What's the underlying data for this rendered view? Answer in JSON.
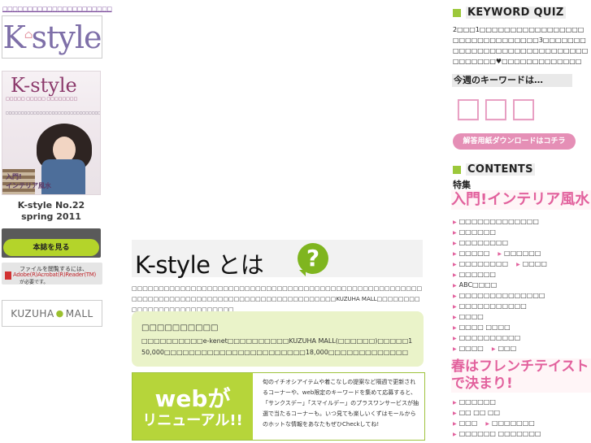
{
  "left": {
    "tiny_link": "□□□□□□□□□□□□□□□□□□□□□□",
    "logo": "K",
    "logo_rest": "style",
    "cover": {
      "title": "K-style",
      "sub": "□□□□□ □□□□□ □□□□□□□□",
      "lines": "□□□□□□□□□□□□□□□□□□□□□□□□□□□□□□□□□□□□□",
      "heading1": "入門!",
      "heading2": "インテリア風水"
    },
    "magazine_title_line1": "K-style No.22",
    "magazine_title_line2": "spring 2011",
    "read_button": "本誌を見る",
    "acrobat": {
      "line1": "ファイルを閲覧するには、",
      "line2": "Adobe(R)Acrobat(R)Reader(TM)",
      "line3": "が必要です。"
    },
    "mall_button_left": "KUZUHA",
    "mall_button_right": "MALL"
  },
  "center": {
    "title": "K-style とは",
    "question_mark": "?",
    "intro": "□□□□□□□□□□□□□□□□□□□□□□□□□□□□□□□□□□□□□□□□□□□□□□□□□□□□□□□□□□□□□□□□□□□□□□□□□□□□□□□□□□□□□□□□□□□□KUZUHA MALL□□□□□□□□□□□□□□□□□□□□□□□□□□□",
    "info_head": "□□□□□□□□□□",
    "info_body": "□□□□□□□□□□e-kenet□□□□□□□□□□KUZUHA MALL(□□□□□□)□□□□□150,000□□□□□□□□□□□□□□□□□□□□□□□18,000□□□□□□□□□□□□□",
    "renewal_word1": "webが",
    "renewal_word2": "リニューアル!!",
    "renewal_desc": "旬のイチオシアイテムや着こなしの提案など隔週で更新されるコーナーや、web限定のキーワードを集めて応募すると、「サンクスデー」「スマイルデー」のプラスワンサービスが抽選で当たるコーナーも。いつ見ても楽しいくずはモールからのホットな情報をあなたもぜひCheckしてね!"
  },
  "right": {
    "quiz_head": "KEYWORD QUIZ",
    "quiz_text": "2□□□1□□□□□□□□□□□□□□□□□□□□□□□□□□□□□□□3□□□□□□□□□□□□□□□□□□□□□□□□□□□□□□□□□□□□♥□□□□□□□□□□□□□",
    "kw_label": "今週のキーワードは…",
    "kw_answer": "□□□",
    "download_button": "解答用紙ダウンロードはコチラ",
    "contents_head": "CONTENTS",
    "feature_label": "特集",
    "feature_title": "入門!インテリア風水",
    "links": [
      [
        "□□□□□□□□□□□□□"
      ],
      [
        "□□□□□□"
      ],
      [
        "□□□□□□□□"
      ],
      [
        "□□□□□",
        "□□□□□□"
      ],
      [
        "□□□□□□□□",
        "□□□□"
      ],
      [
        "□□□□□□"
      ],
      [
        "ABC□□□□"
      ],
      [
        "□□□□□□□□□□□□□□"
      ],
      [
        "□□□□□□□□□□□"
      ],
      [
        "□□□□"
      ],
      [
        "□□□□ □□□□"
      ],
      [
        "□□□□□□□□□□"
      ],
      [
        "□□□□",
        "□□□"
      ]
    ],
    "feature2_title": "春はフレンチテイストで決まり!",
    "links2": [
      [
        "□□□□□□"
      ],
      [
        "□□ □□ □□"
      ],
      [
        "□□□",
        "□□□□□□□"
      ],
      [
        "□□□□□□ □□□□□□□"
      ]
    ]
  }
}
